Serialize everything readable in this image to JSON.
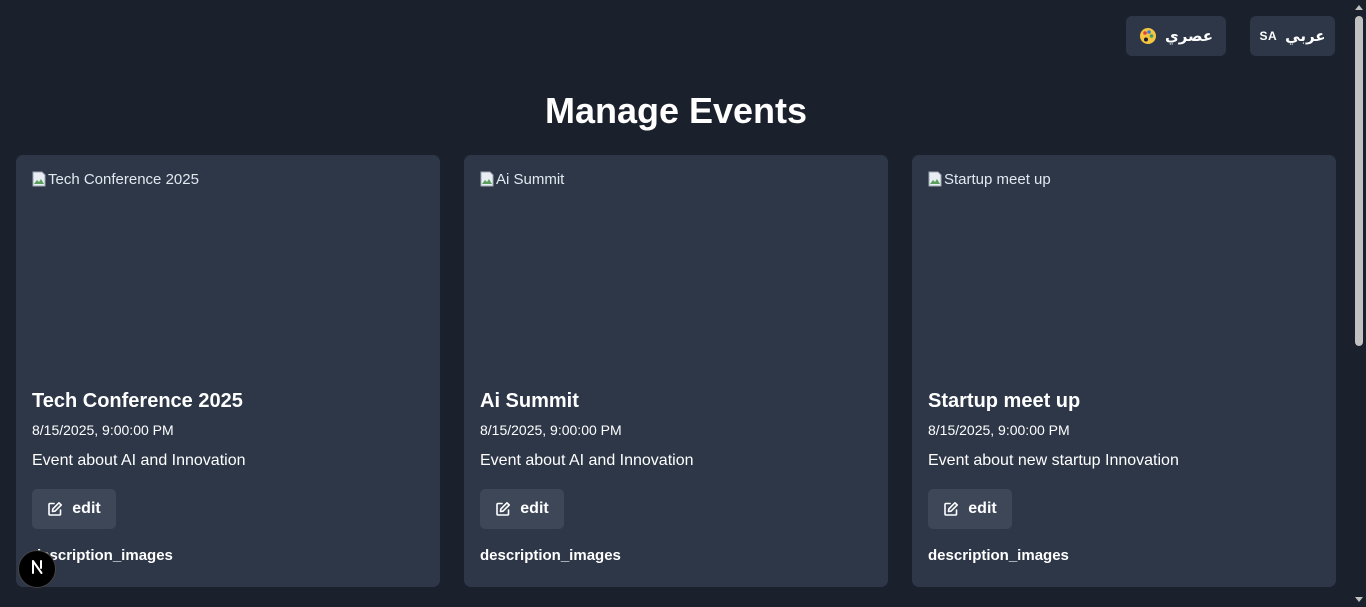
{
  "topbar": {
    "theme_label": "عصري",
    "theme_icon": "palette-icon",
    "language_code": "SA",
    "language_label": "عربي"
  },
  "page_title": "Manage Events",
  "events": [
    {
      "image_alt": "Tech Conference 2025",
      "title": "Tech Conference 2025",
      "date": "8/15/2025, 9:00:00 PM",
      "description": "Event about AI and Innovation",
      "edit_label": "edit",
      "subheading": "description_images"
    },
    {
      "image_alt": "Ai Summit",
      "title": "Ai Summit",
      "date": "8/15/2025, 9:00:00 PM",
      "description": "Event about AI and Innovation",
      "edit_label": "edit",
      "subheading": "description_images"
    },
    {
      "image_alt": "Startup meet up",
      "title": "Startup meet up",
      "date": "8/15/2025, 9:00:00 PM",
      "description": "Event about new startup Innovation",
      "edit_label": "edit",
      "subheading": "description_images"
    }
  ],
  "dev_badge": {
    "icon": "nextjs-icon"
  },
  "colors": {
    "background": "#1a202c",
    "card": "#2d3748",
    "button": "#3d4758",
    "text": "#ffffff"
  }
}
